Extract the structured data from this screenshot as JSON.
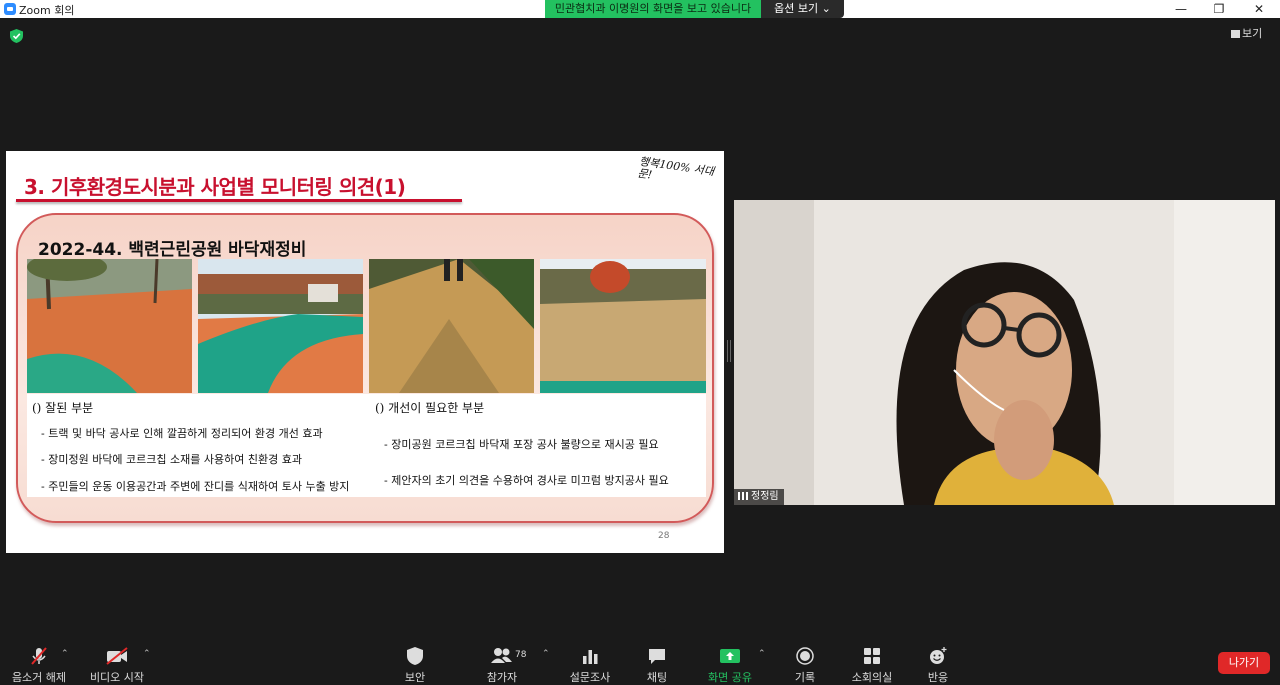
{
  "window": {
    "title": "Zoom 회의",
    "share_banner": "민관협치과 이명원의 화면을 보고 있습니다",
    "view_options": "옵션 보기 ⌄",
    "view_button": "보기",
    "minimize": "—",
    "maximize": "❐",
    "close": "✕"
  },
  "slide": {
    "title": "3. 기후환경도시분과 사업별 모니터링 의견(1)",
    "logo_text": "행복100% 서대문!",
    "project": "2022-44. 백련근린공원 바닥재정비",
    "good": {
      "heading": "() 잘된 부분",
      "items": [
        "- 트랙 및 바닥 공사로 인해 깔끔하게 정리되어 환경 개선 효과",
        "- 장미정원 바닥에 코르크칩 소재를 사용하여 친환경 효과",
        "- 주민들의 운동 이용공간과 주변에 잔디를 식재하여 토사 누출 방지"
      ]
    },
    "bad": {
      "heading": "() 개선이 필요한 부분",
      "items": [
        "- 장미공원 코르크칩 바닥재 포장 공사 불량으로 재시공 필요",
        "- 제안자의 초기 의견을 수용하여 경사로 미끄럼 방지공사 필요"
      ]
    },
    "page_number": "28"
  },
  "participant": {
    "name": "정정림"
  },
  "toolbar": {
    "unmute": "음소거 해제",
    "start_video": "비디오 시작",
    "security": "보안",
    "participants": "참가자",
    "participant_count": "78",
    "polls": "설문조사",
    "chat": "채팅",
    "share_screen": "화면 공유",
    "record": "기록",
    "breakout": "소회의실",
    "reactions": "반응",
    "leave": "나가기"
  },
  "colors": {
    "share_green": "#23c160",
    "leave_red": "#e02828",
    "slide_title_red": "#c8102e"
  }
}
